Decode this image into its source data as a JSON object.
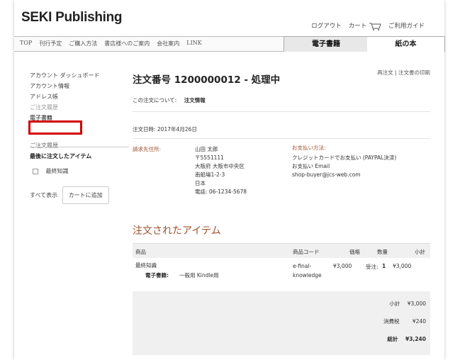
{
  "header": {
    "logo": "SEKI Publishing",
    "logout": "ログアウト",
    "cart": "カート",
    "guide": "ご利用ガイド"
  },
  "nav": {
    "items": [
      "TOP",
      "刊行予定",
      "ご購入方法",
      "書店様へのご案内",
      "会社案内",
      "LINK"
    ],
    "tab_ebook": "電子書籍",
    "tab_paper": "紙の本"
  },
  "sidebar": {
    "items": [
      "アカウント ダッシュボード",
      "アカウント情報",
      "アドレス帳",
      "ご注文履歴",
      "電子書籍"
    ],
    "history_title": "ご注文履歴",
    "last_ordered": "最後に注文したアイテム",
    "last_item": "最終知識",
    "view_all": "すべて表示",
    "add_to_cart": "カートに追加"
  },
  "order": {
    "title": "注文番号 1200000012 - 処理中",
    "reorder": "再注文",
    "divider": "|",
    "print": "注文書の印刷",
    "about_label": "この注文について:",
    "about_value": "注文情報",
    "date": "注文日時: 2017年4月26日",
    "billing_label": "請求先住所:",
    "billing_lines": [
      "山田 太郎",
      "〒5551111",
      "大阪府 大阪市中央区",
      "南船場1-2-3",
      "日本",
      "電話: 06-1234-5678"
    ],
    "payment_label": "お支払い方法:",
    "payment_lines": [
      "クレジットカードでお支払い (PAYPAL決済)",
      "お支払い Email",
      "shop-buyer@jcs-web.com"
    ]
  },
  "items": {
    "title": "注文されたアイテム",
    "columns": [
      "商品",
      "商品コード",
      "価格",
      "数量",
      "小計"
    ],
    "rows": [
      {
        "name": "最終知識",
        "option_label": "電子書籍:",
        "option_value": "一般用 Kindle用",
        "sku_line1": "e-final-",
        "sku_line2": "knowledge",
        "price": "¥3,000",
        "qty_label": "受注:",
        "qty": "1",
        "subtotal": "¥3,000"
      }
    ]
  },
  "totals": {
    "subtotal_label": "小計",
    "subtotal": "¥3,000",
    "tax_label": "消費税",
    "tax": "¥240",
    "grand_label": "総計",
    "grand": "¥3,240"
  },
  "colors": {
    "accent": "#a0522d",
    "highlight": "#d40000"
  }
}
